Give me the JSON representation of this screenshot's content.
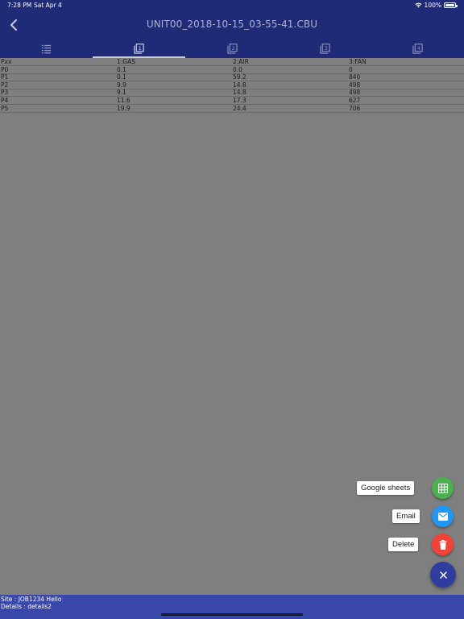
{
  "status_bar": {
    "time": "7:28 PM",
    "date": "Sat Apr 4",
    "battery": "100%"
  },
  "header": {
    "title": "UNIT00_2018-10-15_03-55-41.CBU",
    "tabs": [
      {
        "icon": "list-icon",
        "active": false
      },
      {
        "icon": "page-1-icon",
        "label": "1",
        "active": true
      },
      {
        "icon": "page-2-icon",
        "label": "2",
        "active": false
      },
      {
        "icon": "page-3-icon",
        "label": "3",
        "active": false
      },
      {
        "icon": "page-4-icon",
        "label": "4",
        "active": false
      }
    ]
  },
  "table": {
    "headers": [
      "Pxx",
      "1:GAS",
      "2:AIR",
      "3:FAN"
    ],
    "rows": [
      [
        "P0",
        "0.1",
        "0.0",
        "0"
      ],
      [
        "P1",
        "0.1",
        "59.2",
        "840"
      ],
      [
        "P2",
        "9.9",
        "14.8",
        "498"
      ],
      [
        "P3",
        "9.1",
        "14.8",
        "498"
      ],
      [
        "P4",
        "11.6",
        "17.3",
        "627"
      ],
      [
        "P5",
        "19.9",
        "24.4",
        "706"
      ]
    ]
  },
  "fab_actions": {
    "google_sheets": {
      "label": "Google sheets",
      "color": "#4caf50",
      "icon": "grid-icon"
    },
    "email": {
      "label": "Email",
      "color": "#2196f3",
      "icon": "mail-icon"
    },
    "delete": {
      "label": "Delete",
      "color": "#f44336",
      "icon": "trash-icon"
    },
    "close": {
      "icon": "close-icon",
      "color": "#2f3d9f"
    }
  },
  "footer": {
    "site": "Site : JOB1234 Hello",
    "details": "Details : details2"
  }
}
